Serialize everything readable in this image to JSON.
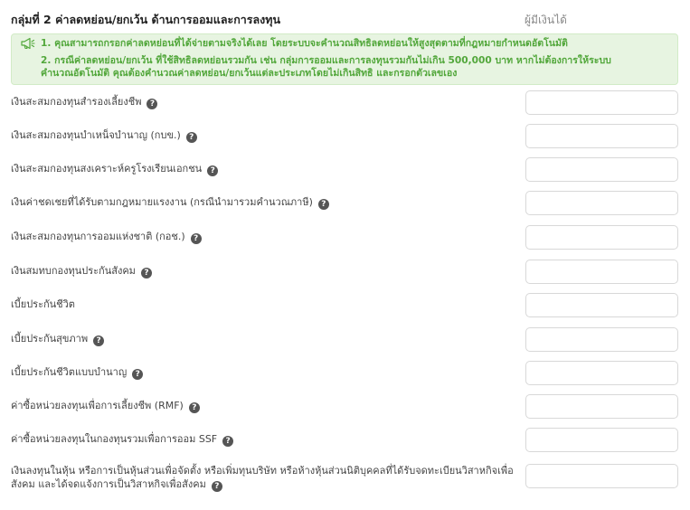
{
  "section": {
    "title": "กลุ่มที่ 2 ค่าลดหย่อน/ยกเว้น ด้านการออมและการลงทุน",
    "column_header": "ผู้มีเงินได้"
  },
  "notice": {
    "icon": "megaphone-icon",
    "line1": "1. คุณสามารถกรอกค่าลดหย่อนที่ได้จ่ายตามจริงได้เลย โดยระบบจะคำนวณสิทธิลดหย่อนให้สูงสุดตามที่กฎหมายกำหนดอัตโนมัติ",
    "line2": "2. กรณีค่าลดหย่อน/ยกเว้น ที่ใช้สิทธิลดหย่อนรวมกัน เช่น กลุ่มการออมและการลงทุนรวมกันไม่เกิน 500,000 บาท หากไม่ต้องการให้ระบบ",
    "line3": "คำนวณอัตโนมัติ คุณต้องคำนวณค่าลดหย่อน/ยกเว้นแต่ละประเภทโดยไม่เกินสิทธิ และกรอกตัวเลขเอง"
  },
  "colors": {
    "notice_bg": "#e7f4e1",
    "notice_text": "#52a73b",
    "help_icon": "#555555"
  },
  "rows": [
    {
      "label": "เงินสะสมกองทุนสำรองเลี้ยงชีพ",
      "value": ""
    },
    {
      "label": "เงินสะสมกองทุนบำเหน็จบำนาญ (กบข.)",
      "value": ""
    },
    {
      "label": "เงินสะสมกองทุนสงเคราะห์ครูโรงเรียนเอกชน",
      "value": ""
    },
    {
      "label": "เงินค่าชดเชยที่ได้รับตามกฎหมายแรงงาน (กรณีนำมารวมคำนวณภาษี)",
      "value": ""
    },
    {
      "label": "เงินสะสมกองทุนการออมแห่งชาติ (กอช.)",
      "value": ""
    },
    {
      "label": "เงินสมทบกองทุนประกันสังคม",
      "value": ""
    },
    {
      "label": "เบี้ยประกันชีวิต",
      "value": ""
    },
    {
      "label": "เบี้ยประกันสุขภาพ",
      "value": ""
    },
    {
      "label": "เบี้ยประกันชีวิตแบบบำนาญ",
      "value": ""
    },
    {
      "label": "ค่าซื้อหน่วยลงทุนเพื่อการเลี้ยงชีพ (RMF)",
      "value": ""
    },
    {
      "label": "ค่าซื้อหน่วยลงทุนในกองทุนรวมเพื่อการออม SSF",
      "value": ""
    },
    {
      "label": "เงินลงทุนในหุ้น หรือการเป็นหุ้นส่วนเพื่อจัดตั้ง หรือเพิ่มทุนบริษัท หรือห้างหุ้นส่วนนิติบุคคลที่ได้รับจดทะเบียนวิสาหกิจเพื่อสังคม และได้จดแจ้งการเป็นวิสาหกิจเพื่อสังคม",
      "value": ""
    }
  ]
}
